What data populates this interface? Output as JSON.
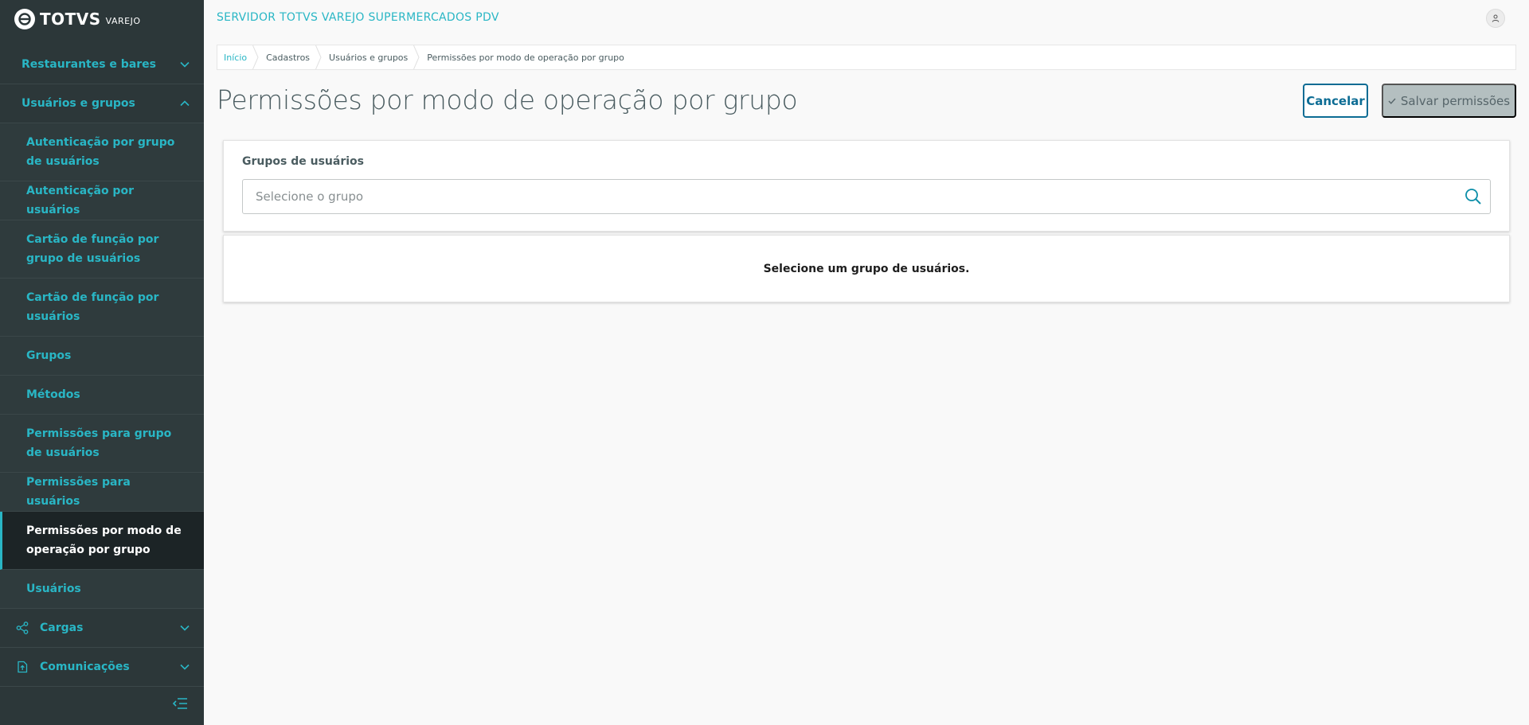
{
  "brand": {
    "name": "TOTVS",
    "sub": "VAREJO"
  },
  "header": {
    "app_title": "SERVIDOR TOTVS VAREJO SUPERMERCADOS PDV"
  },
  "sidebar": {
    "parents": {
      "restaurantes": "Restaurantes e bares",
      "usuarios": "Usuários e grupos",
      "cargas": "Cargas",
      "comunicacoes": "Comunicações"
    },
    "children": [
      "Autenticação por grupo de usuários",
      "Autenticação por usuários",
      "Cartão de função por grupo de usuários",
      "Cartão de função por usuários",
      "Grupos",
      "Métodos",
      "Permissões para grupo de usuários",
      "Permissões para usuários",
      "Permissões por modo de operação por grupo",
      "Usuários"
    ]
  },
  "breadcrumb": [
    "Início",
    "Cadastros",
    "Usuários e grupos",
    "Permissões por modo de operação por grupo"
  ],
  "page": {
    "title": "Permissões por modo de operação por grupo",
    "cancel_label": "Cancelar",
    "save_label": "Salvar permissões"
  },
  "form": {
    "field_label": "Grupos de usuários",
    "placeholder": "Selecione o grupo",
    "value": ""
  },
  "message": "Selecione um grupo de usuários.",
  "colors": {
    "sidebar_bg": "#2c3739",
    "accent": "#29b6c5",
    "primary": "#0c6c94",
    "disabled": "#b4bfc0"
  },
  "icons": [
    "totvs-logo-icon",
    "chevron-down-icon",
    "chevron-up-icon",
    "share-icon",
    "upload-file-icon",
    "collapse-menu-icon",
    "user-icon",
    "check-icon",
    "search-icon"
  ]
}
